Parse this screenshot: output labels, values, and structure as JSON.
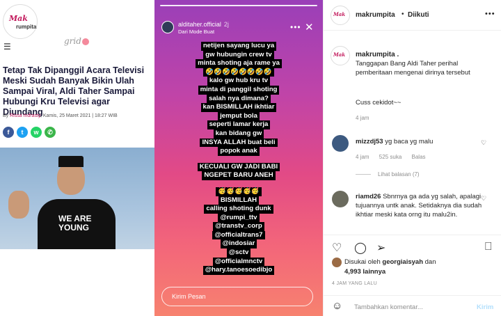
{
  "article": {
    "brand_logo_main": "Mak",
    "brand_logo_sub": "rumpita",
    "grid_logo": "grid",
    "headline": "Tetap Tak Dipanggil Acara Televisi Meski Sudah Banyak Bikin Ulah Sampai Viral, Aldi Taher Sampai Hubungi Kru Televisi agar Diundang",
    "by_prefix": "By",
    "author": "Rissa Indrasty",
    "date": ", Kamis, 25 Maret 2021 | 18:27 WIB",
    "share_labels": [
      "f",
      "t",
      "w",
      "✆"
    ],
    "shirt_text_1": "WE ARE",
    "shirt_text_2": "YOUNG"
  },
  "story": {
    "username": "alditaher.official",
    "time": "2j",
    "subtitle": "Dari Mode Buat",
    "more_icon": "•••",
    "close_icon": "✕",
    "lines": [
      "netijen sayang lucu ya",
      "gw hubungin crew tv",
      "minta shoting aja rame ya",
      "🤣🤣🤣🤣🤣🤣🤣🤣",
      "kalo gw hub kru tv",
      "minta di panggil shoting",
      "salah nya dimana?",
      "kan BISMILLAH ikhtiar",
      "jemput bola",
      "seperti lamar kerja",
      "kan bidang gw",
      "INSYA ALLAH buat beli",
      "popok anak",
      "",
      "KECUALI GW JADI BABI",
      "NGEPET BARU ANEH",
      "",
      "🥳🥳🥳🥳🥳",
      "BISMILLAH",
      "calling shoting dunk",
      "@rumpi_ttv",
      "@transtv_corp",
      "@officialtrans7",
      "@indosiar",
      "@sctv",
      "@officialmnctv",
      "@hary.tanoesoedibjo"
    ],
    "reply_placeholder": "Kirim Pesan"
  },
  "side": {
    "header": {
      "username": "makrumpita",
      "dot": "•",
      "follow_label": "Diikuti",
      "more_icon": "•••"
    },
    "caption": {
      "username": "makrumpita",
      "suffix": " .",
      "text": "Tanggapan Bang Aldi Taher perihal pemberitaan mengenai dirinya tersebut",
      "text2": "Cuss cekidot~~",
      "time": "4 jam"
    },
    "comments": [
      {
        "username": "mizzdj53",
        "text": " yg baca yg malu",
        "time": "4 jam",
        "likes": "525 suka",
        "reply": "Balas",
        "view_replies": "Lihat balasan (7)"
      },
      {
        "username": "riamd26",
        "text": " Sbnrnya ga ada yg salah, apalagi tujuannya untk anak. Setidaknya dia sudah ikhtiar meski kata orng itu malu2in."
      }
    ],
    "likes_line1_prefix": "Disukai oleh ",
    "likes_line1_user": "georgiaisyah",
    "likes_line1_suffix": " dan",
    "likes_line2_count": "4,993",
    "likes_line2_suffix": " lainnya",
    "posted_ago": "4 JAM YANG LALU",
    "comment_placeholder": "Tambahkan komentar...",
    "post_label": "Kirim"
  }
}
